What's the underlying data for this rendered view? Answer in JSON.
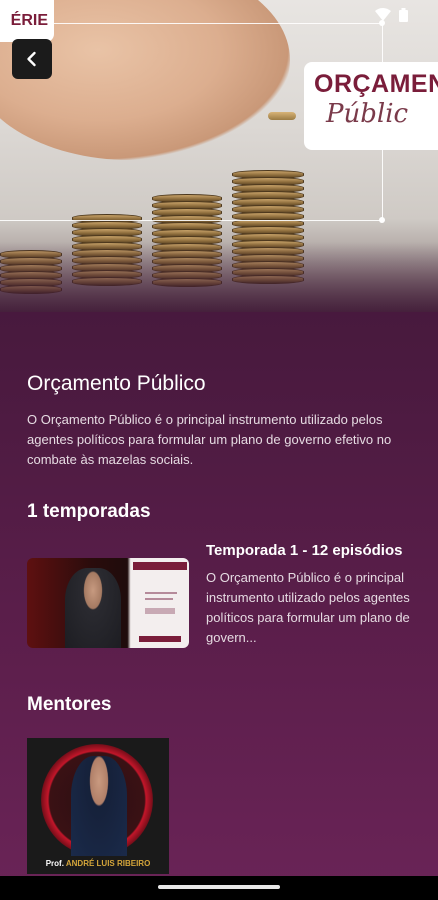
{
  "hero": {
    "series_badge": "ÉRIE",
    "title_card_line1": "ORÇAMEN",
    "title_card_line2": "Públic"
  },
  "show": {
    "title": "Orçamento Público",
    "description": "O Orçamento Público é o principal instrumento utilizado pelos agentes políticos para formular um plano de governo efetivo no combate às mazelas sociais."
  },
  "seasons": {
    "heading": "1 temporadas",
    "items": [
      {
        "name": "Temporada 1 - 12 episódios",
        "description": "O Orçamento Público é o principal instrumento utilizado pelos agentes políticos para formular um plano de govern..."
      }
    ]
  },
  "mentors": {
    "heading": "Mentores",
    "items": [
      {
        "name_prefix": "Prof.",
        "name": "ANDRÉ LUIS RIBEIRO"
      }
    ]
  },
  "icons": {
    "back": "chevron-left-icon",
    "wifi": "wifi-icon",
    "battery": "battery-icon"
  },
  "colors": {
    "accent": "#7a1d3a",
    "background_top": "#3c1434",
    "background_bottom": "#6a2457"
  }
}
